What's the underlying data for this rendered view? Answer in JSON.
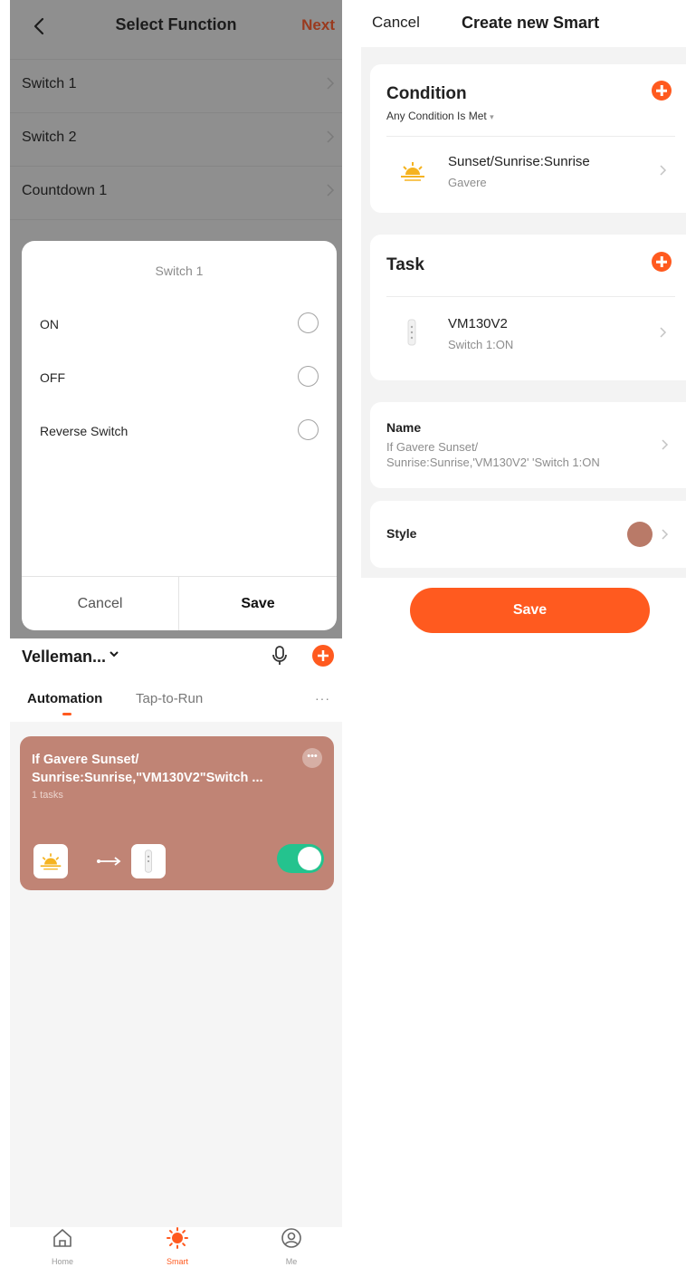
{
  "select_function": {
    "title": "Select Function",
    "next_label": "Next",
    "rows": [
      {
        "label": "Switch 1"
      },
      {
        "label": "Switch 2"
      },
      {
        "label": "Countdown 1"
      }
    ],
    "dialog": {
      "title": "Switch 1",
      "options": [
        {
          "label": "ON",
          "selected": false
        },
        {
          "label": "OFF",
          "selected": false
        },
        {
          "label": "Reverse Switch",
          "selected": false
        }
      ],
      "cancel_label": "Cancel",
      "save_label": "Save"
    }
  },
  "create_smart": {
    "cancel_label": "Cancel",
    "title": "Create new Smart",
    "condition": {
      "title": "Condition",
      "mode": "Any Condition Is Met",
      "item": {
        "title": "Sunset/Sunrise:Sunrise",
        "subtitle": "Gavere",
        "icon": "sunrise-icon"
      }
    },
    "task": {
      "title": "Task",
      "item": {
        "title": "VM130V2",
        "subtitle": "Switch 1:ON",
        "icon": "device-icon"
      }
    },
    "name": {
      "label": "Name",
      "value_line1": "If Gavere Sunset/",
      "value_line2": "Sunrise:Sunrise,'VM130V2' 'Switch 1:ON"
    },
    "style": {
      "label": "Style",
      "color": "#b97a68"
    },
    "save_label": "Save",
    "accent_color": "#ff5a1f"
  },
  "smart_list": {
    "home_name": "Velleman...",
    "tabs": [
      {
        "label": "Automation",
        "active": true
      },
      {
        "label": "Tap-to-Run",
        "active": false
      }
    ],
    "more_label": "···",
    "scene": {
      "name_line1": "If Gavere Sunset/",
      "name_line2": "Sunrise:Sunrise,\"VM130V2\"Switch ...",
      "tasks": "1 tasks",
      "enabled": true,
      "card_color": "#c08475",
      "toggle_color": "#24c38e"
    },
    "bottom_nav": [
      {
        "label": "Home",
        "icon": "home-icon",
        "active": false
      },
      {
        "label": "Smart",
        "icon": "smart-icon",
        "active": true
      },
      {
        "label": "Me",
        "icon": "profile-icon",
        "active": false
      }
    ]
  }
}
